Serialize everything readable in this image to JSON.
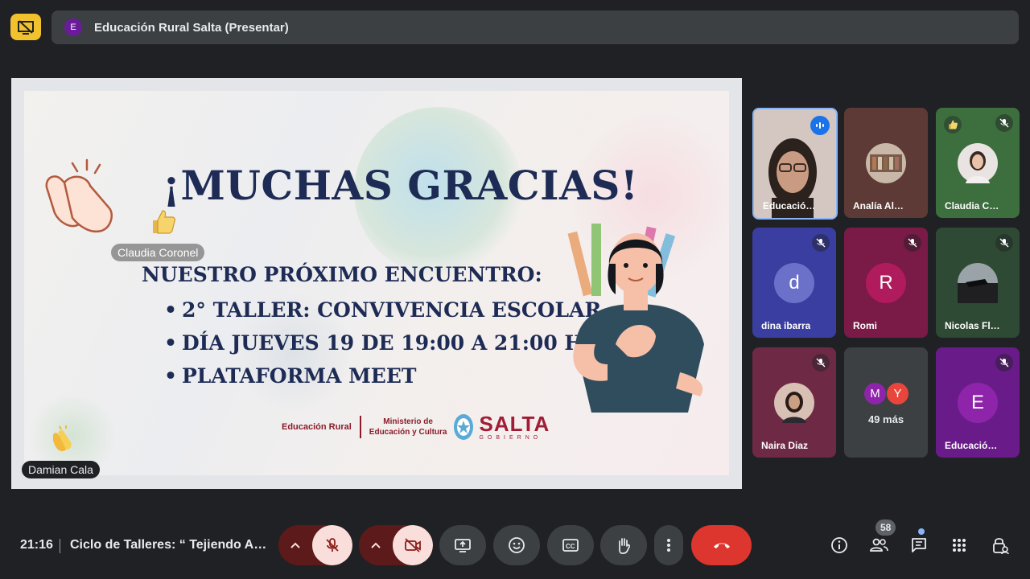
{
  "header": {
    "presenter_initial": "E",
    "presenter_title": "Educación Rural Salta (Presentar)"
  },
  "slide": {
    "title": "¡MUCHAS GRACIAS!",
    "subtitle": "NUESTRO PRÓXIMO ENCUENTRO:",
    "bullets": [
      "2° TALLER: CONVIVENCIA ESCOLAR",
      "DÍA JUEVES 19 DE 19:00 A 21:00 HS",
      "PLATAFORMA MEET"
    ],
    "logo_rural": "Educación Rural",
    "logo_ministry_1": "Ministerio de",
    "logo_ministry_2": "Educación y Cultura",
    "logo_salta": "SALTA",
    "logo_gobierno": "GOBIERNO"
  },
  "overlays": {
    "reaction_name_1": "Claudia Coronel",
    "reaction_name_2": "Damian Cala"
  },
  "participants": [
    {
      "name": "Educació…",
      "kind": "video",
      "speaking": true
    },
    {
      "name": "Analía Al…",
      "kind": "photo",
      "bg": "#5d3a35"
    },
    {
      "name": "Claudia C…",
      "kind": "photo",
      "bg": "#3c6e3e",
      "muted": true
    },
    {
      "name": "dina ibarra",
      "initial": "d",
      "bg": "#3a3ea0",
      "circle": "#6b71c9",
      "muted": true
    },
    {
      "name": "Romi",
      "initial": "R",
      "bg": "#7a1a46",
      "circle": "#b01b5d",
      "muted": true
    },
    {
      "name": "Nicolas Fl…",
      "kind": "photo",
      "bg": "#2e4a34",
      "muted": true
    },
    {
      "name": "Naira Diaz",
      "kind": "photo",
      "bg": "#6e2a45",
      "muted": true
    },
    {
      "more_label": "49 más",
      "avatar_m": "M",
      "avatar_y": "Y"
    },
    {
      "name": "Educació…",
      "initial": "E",
      "bg": "#6a1b8a",
      "circle": "#8e24aa",
      "muted": true
    }
  ],
  "bottom": {
    "time": "21:16",
    "meeting_title": "Ciclo de Talleres: “ Tejiendo A…",
    "participant_count": "58"
  },
  "colors": {
    "end_call": "#dc362e",
    "mic_off_bg": "#f9dedc",
    "present_icon": "#f2c12e"
  }
}
